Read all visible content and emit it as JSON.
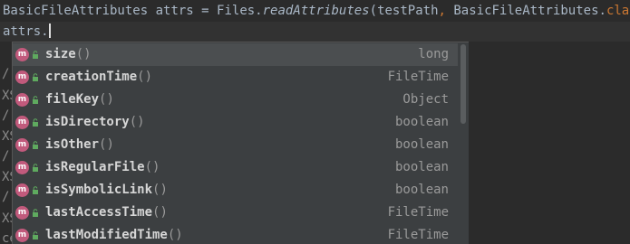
{
  "editor": {
    "line1": {
      "type_name": "BasicFileAttributes",
      "var_name": " attrs",
      "assign": " = ",
      "receiver": "Files.",
      "method": "readAttributes",
      "open_paren": "(",
      "arg1": "testPath",
      "comma": ", ",
      "arg2": "BasicFileAttributes.",
      "class_kw": "class",
      "close": ");"
    },
    "line2": {
      "text": "attrs."
    },
    "left_fragments": [
      "/",
      "XS",
      "/",
      "XS",
      "/",
      "XS",
      "/",
      "XS",
      "ce"
    ]
  },
  "completion": {
    "items": [
      {
        "name": "size",
        "parens": "()",
        "type": "long",
        "icon_letter": "m",
        "selected": true
      },
      {
        "name": "creationTime",
        "parens": "()",
        "type": "FileTime",
        "icon_letter": "m"
      },
      {
        "name": "fileKey",
        "parens": "()",
        "type": "Object",
        "icon_letter": "m"
      },
      {
        "name": "isDirectory",
        "parens": "()",
        "type": "boolean",
        "icon_letter": "m"
      },
      {
        "name": "isOther",
        "parens": "()",
        "type": "boolean",
        "icon_letter": "m"
      },
      {
        "name": "isRegularFile",
        "parens": "()",
        "type": "boolean",
        "icon_letter": "m"
      },
      {
        "name": "isSymbolicLink",
        "parens": "()",
        "type": "boolean",
        "icon_letter": "m"
      },
      {
        "name": "lastAccessTime",
        "parens": "()",
        "type": "FileTime",
        "icon_letter": "m"
      },
      {
        "name": "lastModifiedTime",
        "parens": "()",
        "type": "FileTime",
        "icon_letter": "m"
      }
    ]
  },
  "colors": {
    "background": "#2b2b2b",
    "popup_background": "#3c3f41",
    "selected_row": "#4b4e50",
    "method_icon": "#c15a7c",
    "keyword": "#cc7832"
  }
}
